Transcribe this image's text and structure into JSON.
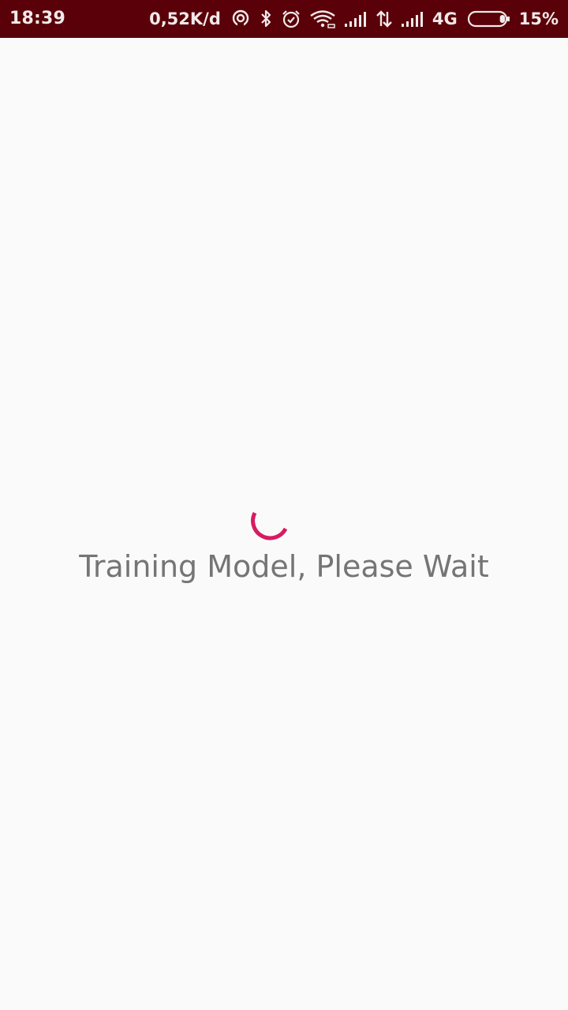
{
  "status_bar": {
    "time": "18:39",
    "network_speed": "0,52K/d",
    "network_type": "4G",
    "battery_percent": "15%",
    "battery_level": 0.15,
    "icons": [
      "hotspot-icon",
      "bluetooth-icon",
      "alarm-icon",
      "wifi-icon",
      "signal-icon",
      "data-arrows-icon",
      "signal-icon",
      "battery-icon"
    ],
    "background_color": "#5a0008"
  },
  "main": {
    "loading_text": "Training Model, Please Wait",
    "spinner_color": "#d81b60",
    "background_color": "#fafafa"
  }
}
